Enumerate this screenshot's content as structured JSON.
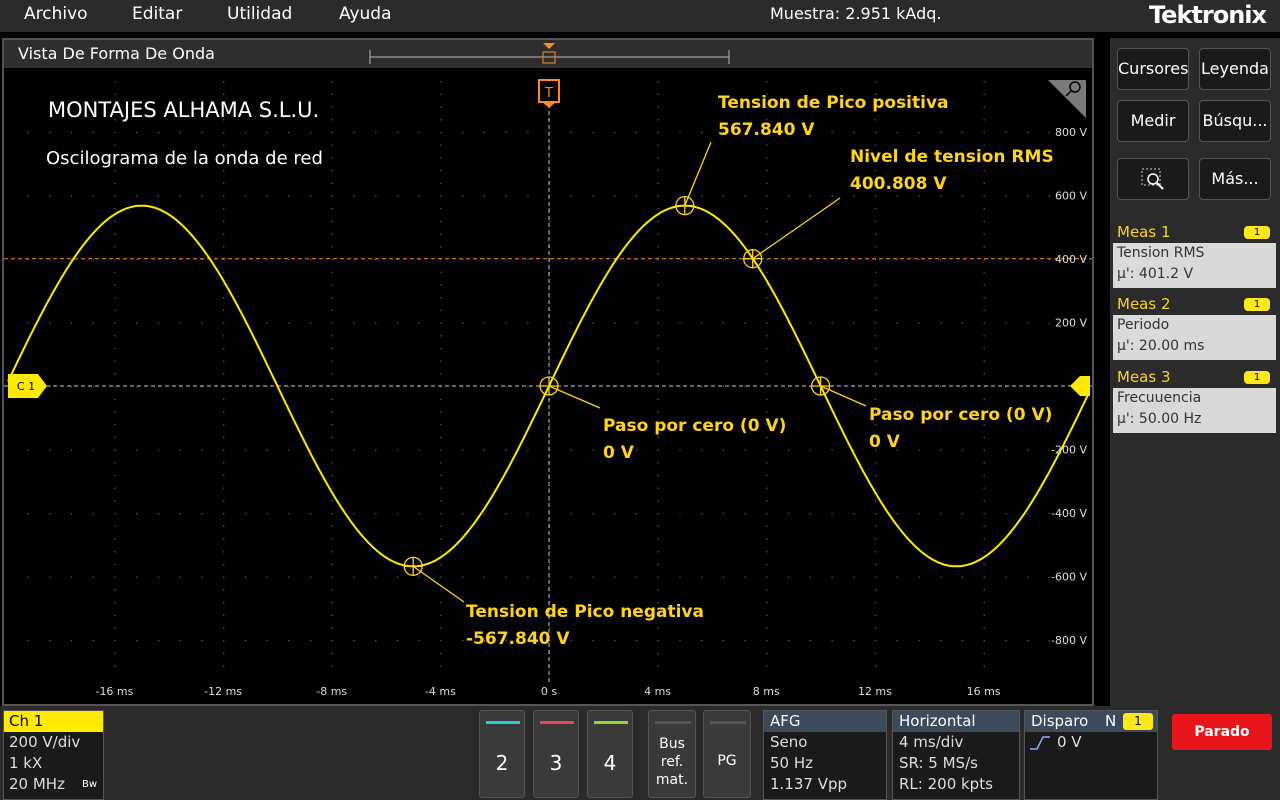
{
  "menu": {
    "items": [
      "Archivo",
      "Editar",
      "Utilidad",
      "Ayuda"
    ]
  },
  "acquisition": "Muestra: 2.951 kAdq.",
  "brand": "Tektronix",
  "waveform_view": {
    "title": "Vista De Forma De Onda",
    "header_line1": "MONTAJES ALHAMA S.L.U.",
    "header_line2": "Oscilograma de la onda de red",
    "trigger_marker": "T",
    "channel_marker": "C 1",
    "y_tick_labels": [
      "800 V",
      "600 V",
      "400 V",
      "200 V",
      "-200 V",
      "-400 V",
      "-600 V",
      "-800 V"
    ],
    "x_tick_labels": [
      "-16 ms",
      "-12 ms",
      "-8 ms",
      "-4 ms",
      "0 s",
      "4 ms",
      "8 ms",
      "12 ms",
      "16 ms"
    ],
    "annotations": {
      "peak_pos": {
        "label": "Tension de Pico positiva",
        "value": "567.840 V"
      },
      "rms": {
        "label": "Nivel de tension RMS",
        "value": "400.808 V"
      },
      "zero1": {
        "label": "Paso por cero (0 V)",
        "value": "0 V"
      },
      "zero2": {
        "label": "Paso por cero (0 V)",
        "value": "0 V"
      },
      "peak_neg": {
        "label": "Tension de Pico negativa",
        "value": "-567.840 V"
      }
    },
    "trace_color": "#ffea00",
    "annotation_color": "#ffd21f",
    "trigger_color": "#ff8c1a"
  },
  "chart_data": {
    "type": "line",
    "title": "",
    "xlabel": "",
    "ylabel": "",
    "xlim": [
      -20,
      20
    ],
    "ylim": [
      -800,
      800
    ],
    "series": [
      {
        "waveform": "sine",
        "amplitude": 567.84,
        "frequency_hz": 50,
        "phase_deg": 0
      }
    ],
    "reference_lines": [
      400.808,
      0
    ]
  },
  "right_panel": {
    "buttons": [
      "Cursores",
      "Leyenda",
      "Medir",
      "Búsqu...",
      "Más..."
    ],
    "measurements": [
      {
        "title": "Meas 1",
        "badge": "1",
        "name": "Tension RMS",
        "value": "μ': 401.2 V"
      },
      {
        "title": "Meas 2",
        "badge": "1",
        "name": "Periodo",
        "value": "μ': 20.00 ms"
      },
      {
        "title": "Meas 3",
        "badge": "1",
        "name": "Frecuuencia",
        "value": "μ': 50.00 Hz"
      }
    ]
  },
  "bottom": {
    "ch1": {
      "title": "Ch 1",
      "lines": [
        "200 V/div",
        "1 kX",
        "20 MHz"
      ],
      "bw": "Bw"
    },
    "channels": [
      {
        "label": "2",
        "color": "#1fd3d3"
      },
      {
        "label": "3",
        "color": "#e8455a"
      },
      {
        "label": "4",
        "color": "#8fd62f"
      }
    ],
    "bus_label": "Bus ref. mat.",
    "pg_label": "PG",
    "afg": {
      "title": "AFG",
      "lines": [
        "Seno",
        "50 Hz",
        "1.137 Vpp"
      ]
    },
    "horizontal": {
      "title": "Horizontal",
      "lines": [
        "4 ms/div",
        "SR: 5 MS/s",
        "RL: 200 kpts"
      ]
    },
    "trigger": {
      "title": "Disparo",
      "mode": "N",
      "badge": "1",
      "level": "0 V"
    },
    "stop_button": "Parado"
  }
}
